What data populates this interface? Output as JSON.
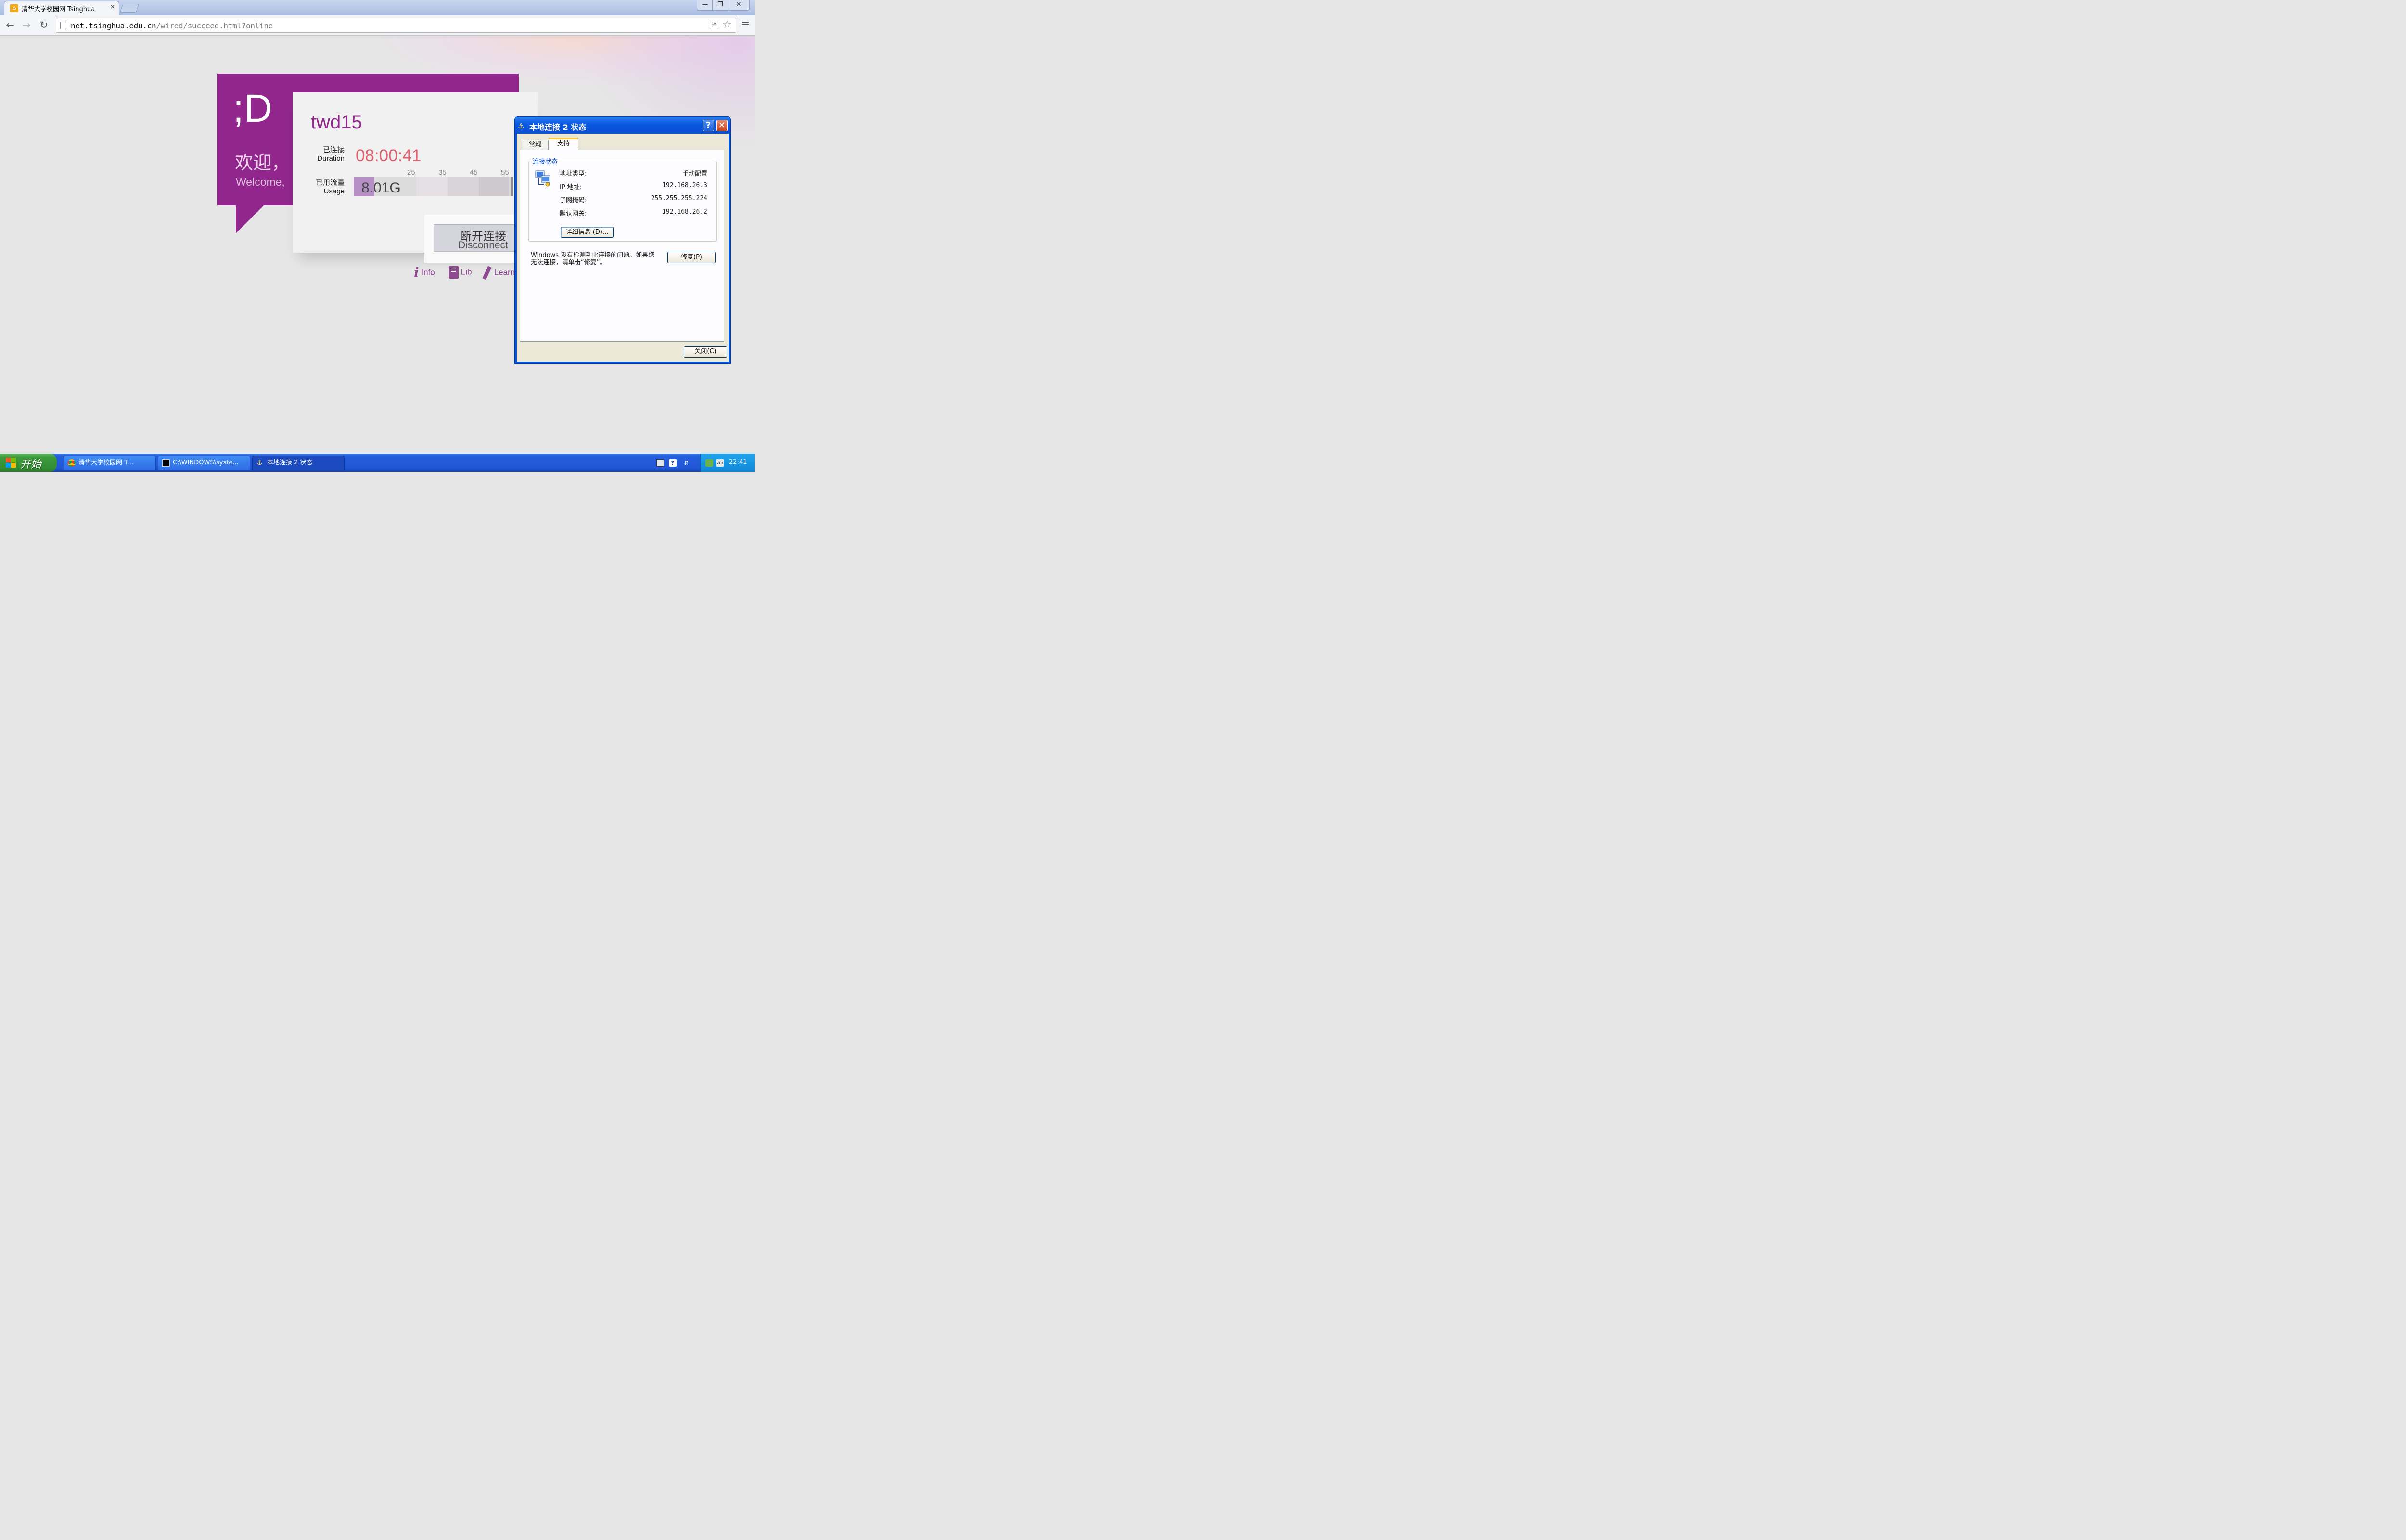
{
  "browser": {
    "tab_title": "清华大学校园网 Tsinghua",
    "tab_close": "×",
    "url_host": "net.tsinghua.edu.cn",
    "url_path": "/wired/succeed.html?online",
    "window_controls": {
      "min": "—",
      "max": "❐",
      "close": "✕"
    },
    "nav": {
      "back": "←",
      "forward": "→",
      "reload": "↻",
      "star": "☆",
      "menu": "≡"
    }
  },
  "page": {
    "smiley": ";D",
    "welcome_cn": "欢迎，",
    "welcome_en": "Welcome,",
    "username": "twd15",
    "duration_label_cn": "已连接",
    "duration_label_en": "Duration",
    "duration": "08:00:41",
    "usage_label_cn": "已用流量",
    "usage_label_en": "Usage",
    "usage": "8.01G",
    "usage_fill_fraction": 0.13,
    "usage_ticks": [
      "25",
      "35",
      "45",
      "55"
    ],
    "disconnect_cn": "断开连接",
    "disconnect_en": "Disconnect",
    "links": {
      "info": "Info",
      "lib": "Lib",
      "learn": "Learn"
    },
    "accent_color": "#91278d"
  },
  "dialog": {
    "title": "本地连接 2 状态",
    "tabs": [
      "常规",
      "支持"
    ],
    "group_title": "连接状态",
    "rows": [
      {
        "label": "地址类型:",
        "value": "手动配置"
      },
      {
        "label": "IP 地址:",
        "value": "192.168.26.3"
      },
      {
        "label": "子网掩码:",
        "value": "255.255.255.224"
      },
      {
        "label": "默认网关:",
        "value": "192.168.26.2"
      }
    ],
    "details_button": "详细信息 (D)...",
    "message": "Windows 没有检测到此连接的问题。如果您无法连接，请单击“修复”。",
    "repair_button": "修复(P)",
    "close_button": "关闭(C)"
  },
  "taskbar": {
    "start": "开始",
    "tasks": [
      "清华大学校园网 T...",
      "C:\\WINDOWS\\syste...",
      "本地连接 2 状态"
    ],
    "clock": "22:41"
  }
}
